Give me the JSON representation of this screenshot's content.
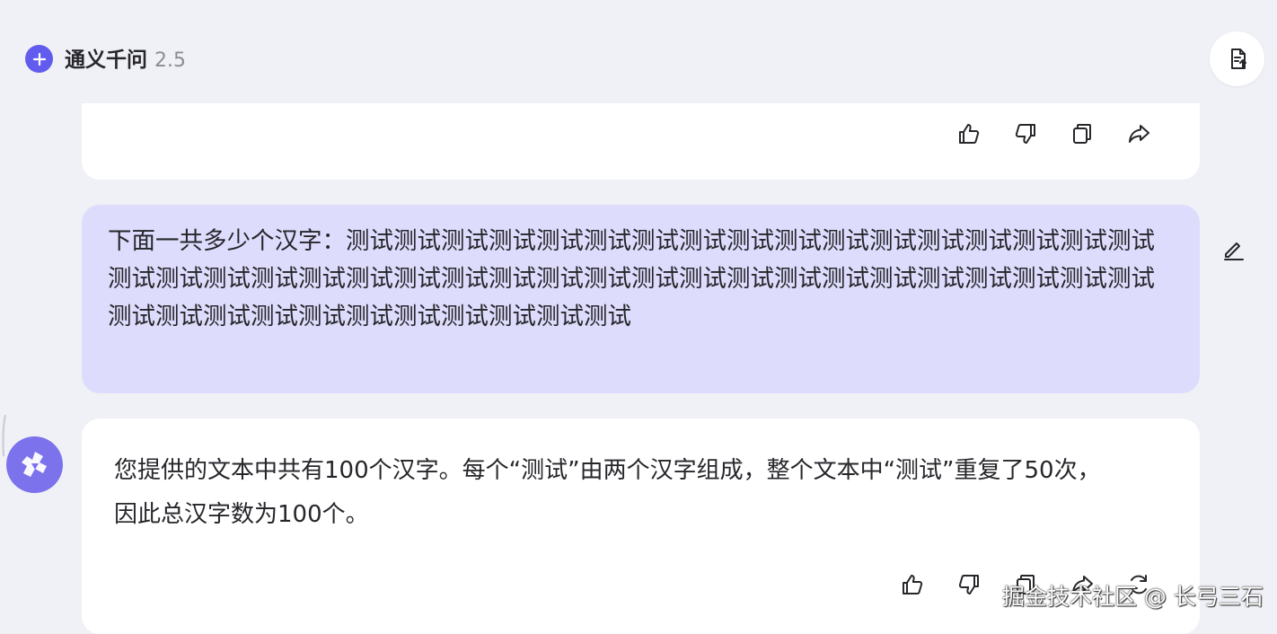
{
  "header": {
    "title": "通义千问",
    "version": "2.5",
    "new_chat_icon": "plus-icon",
    "action_icon": "export-document-icon",
    "accent_color": "#615ced"
  },
  "previous_message": {
    "actions": [
      "thumbs-up-icon",
      "thumbs-down-icon",
      "copy-icon",
      "share-icon"
    ]
  },
  "user_message": {
    "text": "下面一共多少个汉字：测试测试测试测试测试测试测试测试测试测试测试测试测试测试测试测试测试测试测试测试测试测试测试测试测试测试测试测试测试测试测试测试测试测试测试测试测试测试测试测试测试测试测试测试测试测试测试测试测试测试",
    "edit_icon": "pencil-icon",
    "bubble_color": "#dedcfc"
  },
  "assistant_message": {
    "line1": "您提供的文本中共有100个汉字。每个“测试”由两个汉字组成，整个文本中“测试”重复了50次，",
    "line2": "因此总汉字数为100个。",
    "avatar_icon": "tongyi-logo-icon",
    "actions": [
      "thumbs-up-icon",
      "thumbs-down-icon",
      "copy-icon",
      "share-icon",
      "regenerate-icon"
    ]
  },
  "watermark": "掘金技术社区 @ 长弓三石"
}
